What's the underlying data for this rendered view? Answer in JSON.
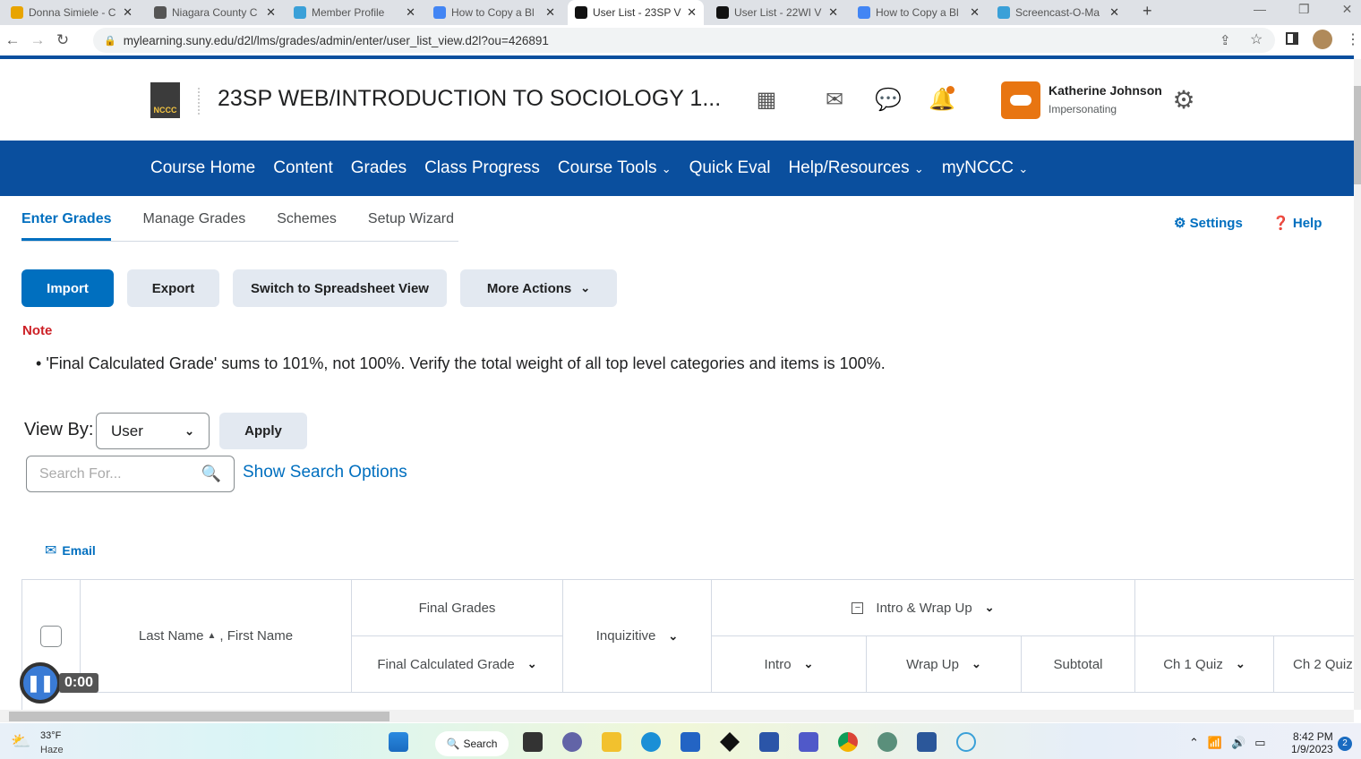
{
  "browser": {
    "tabs": [
      {
        "title": "Donna Simiele - C",
        "color": "#e8a400"
      },
      {
        "title": "Niagara County C",
        "color": "#555555"
      },
      {
        "title": "Member Profile",
        "color": "#3aa0d8"
      },
      {
        "title": "How to Copy a Bl",
        "color": "#4285f4"
      },
      {
        "title": "User List - 23SP V",
        "color": "#111111",
        "active": true
      },
      {
        "title": "User List - 22WI V",
        "color": "#111111"
      },
      {
        "title": "How to Copy a Bl",
        "color": "#4285f4"
      },
      {
        "title": "Screencast-O-Ma",
        "color": "#3aa0d8"
      }
    ],
    "new_tab": "+",
    "url": "mylearning.suny.edu/d2l/lms/grades/admin/enter/user_list_view.d2l?ou=426891"
  },
  "header": {
    "logo": "NCCC",
    "course_title": "23SP WEB/INTRODUCTION TO SOCIOLOGY 1...",
    "user_name": "Katherine Johnson",
    "user_status": "Impersonating",
    "accent": "#e87511"
  },
  "nav": {
    "items": [
      "Course Home",
      "Content",
      "Grades",
      "Class Progress",
      "Course Tools",
      "Quick Eval",
      "Help/Resources",
      "myNCCC"
    ]
  },
  "subtabs": {
    "items": [
      "Enter Grades",
      "Manage Grades",
      "Schemes",
      "Setup Wizard"
    ],
    "settings": "Settings",
    "help": "Help"
  },
  "actions": {
    "import": "Import",
    "export": "Export",
    "switch": "Switch to Spreadsheet View",
    "more": "More Actions"
  },
  "note": {
    "label": "Note",
    "message": "'Final Calculated Grade' sums to 101%, not 100%. Verify the total weight of all top level categories and items is 100%."
  },
  "filters": {
    "view_by_label": "View By:",
    "view_by_value": "User",
    "apply": "Apply",
    "search_placeholder": "Search For...",
    "show_search_options": "Show Search Options"
  },
  "email": "Email",
  "table": {
    "name_header": "Last Name",
    "name_header2": ", First Name",
    "final_grades": "Final Grades",
    "final_calculated": "Final Calculated Grade",
    "inquizitive": "Inquizitive",
    "intro_wrap": "Intro & Wrap Up",
    "intro": "Intro",
    "wrap_up": "Wrap Up",
    "subtotal": "Subtotal",
    "ch1": "Ch 1 Quiz",
    "ch2": "Ch 2 Quiz"
  },
  "recorder": {
    "time": "0:00"
  },
  "taskbar": {
    "temp": "33°F",
    "weather": "Haze",
    "search": "Search",
    "time": "8:42 PM",
    "date": "1/9/2023",
    "notifications": "2"
  }
}
